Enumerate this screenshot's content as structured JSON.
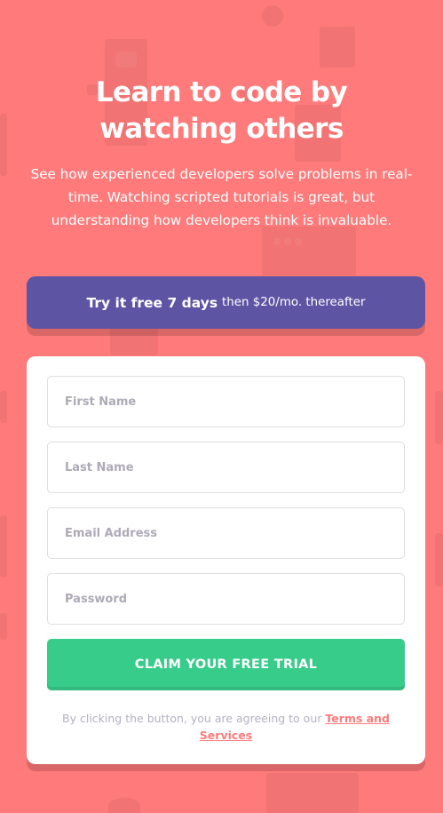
{
  "hero": {
    "title_line1": "Learn to code by",
    "title_line2": "watching others",
    "description": "See how experienced developers solve problems in real-time. Watching scripted tutorials is great, but understanding how developers think is invaluable."
  },
  "promo": {
    "strong": "Try it free 7 days",
    "rest": "then $20/mo. thereafter"
  },
  "form": {
    "first_name_placeholder": "First Name",
    "last_name_placeholder": "Last Name",
    "email_placeholder": "Email Address",
    "password_placeholder": "Password",
    "submit_label": "CLAIM YOUR FREE TRIAL",
    "terms_prefix": "By clicking the button, you are agreeing to our ",
    "terms_link": "Terms and Services"
  },
  "colors": {
    "background": "#ff7a7a",
    "promo": "#5e54a4",
    "cta": "#38cc8b"
  }
}
